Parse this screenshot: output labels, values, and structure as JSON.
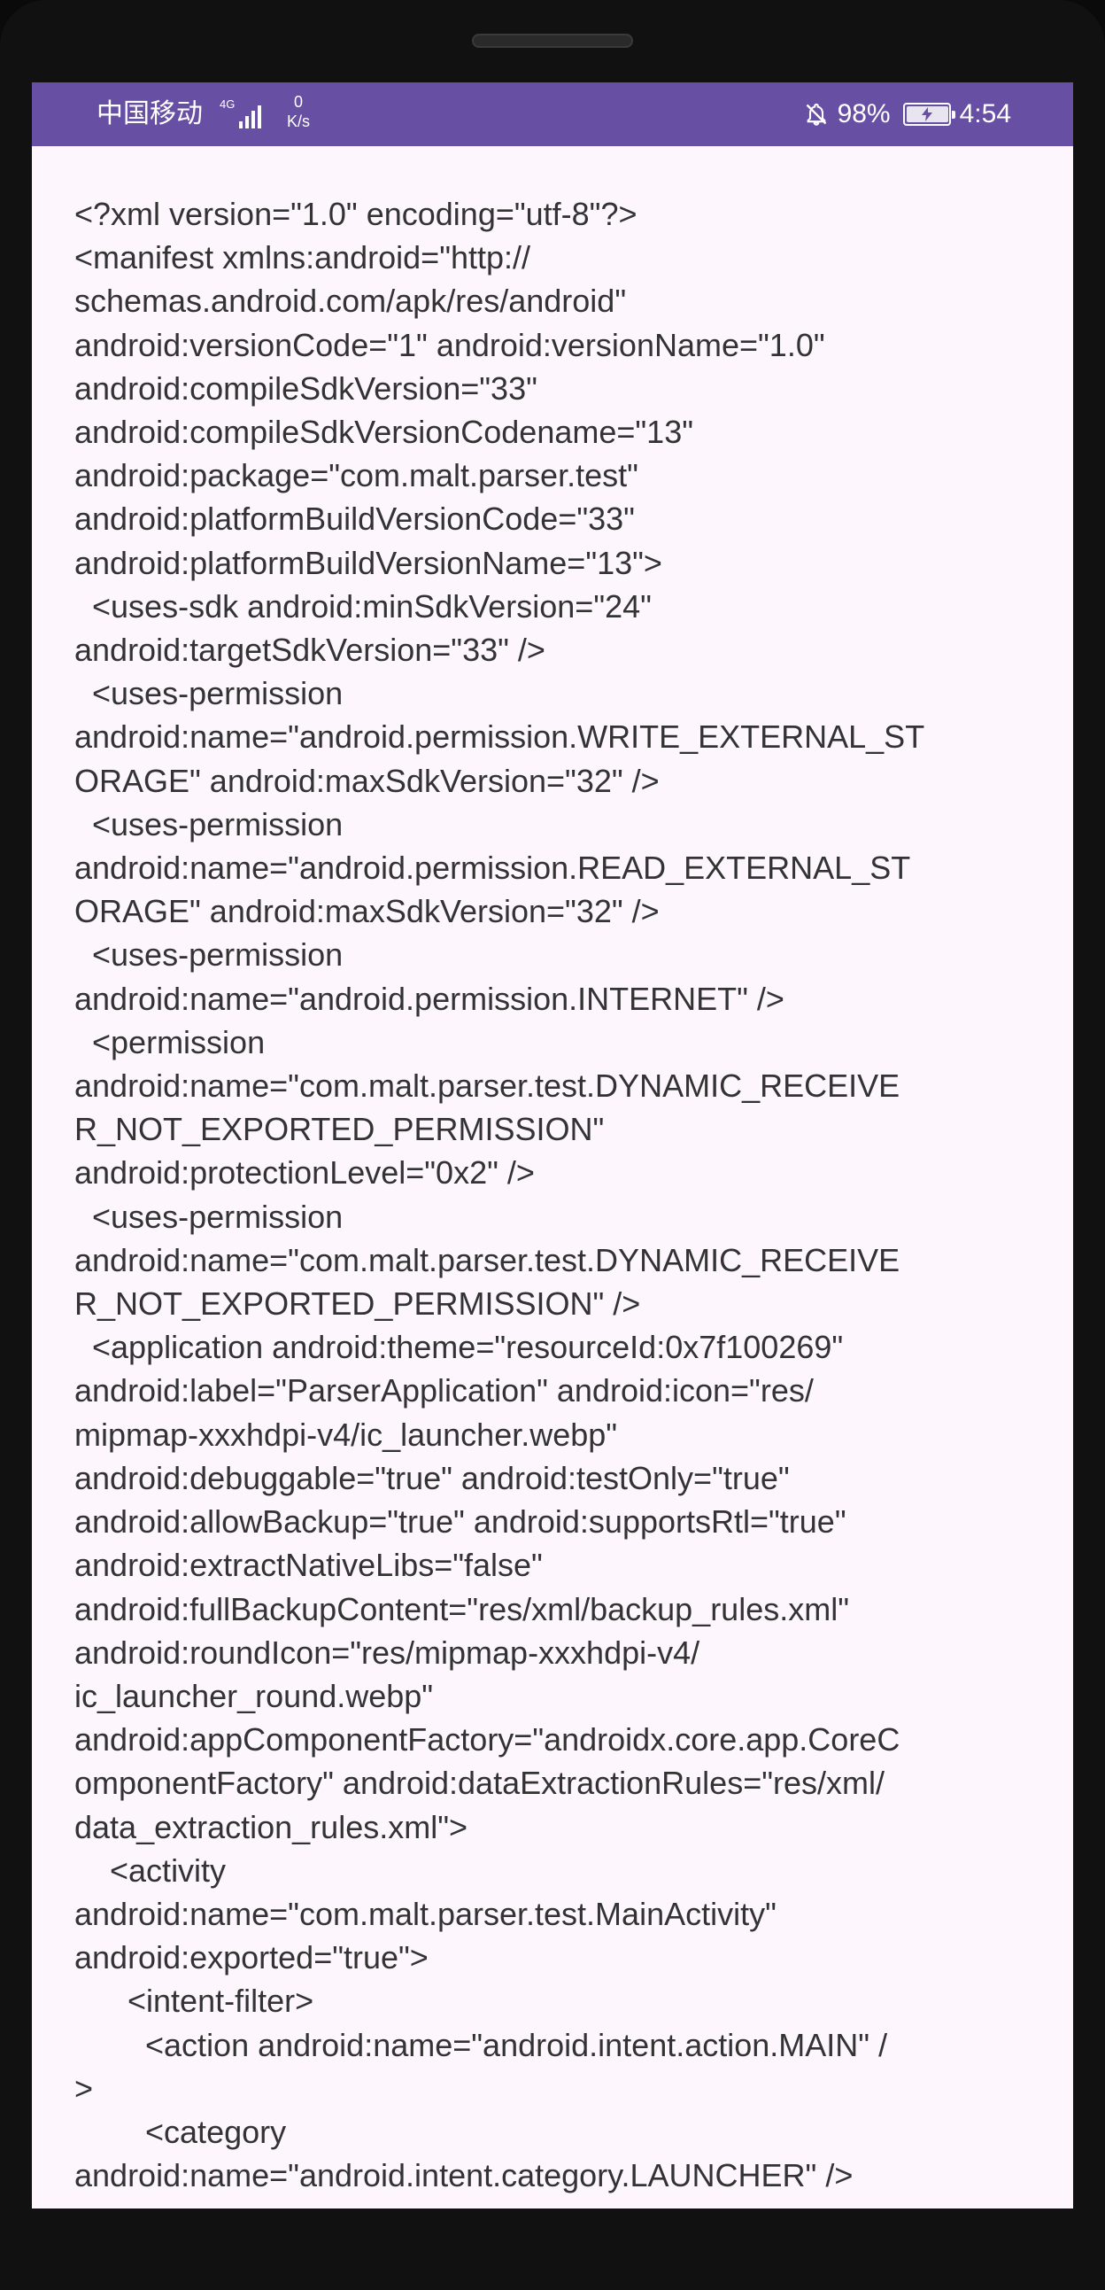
{
  "status_bar": {
    "carrier": "中国移动",
    "network": "4G",
    "speed_value": "0",
    "speed_unit": "K/s",
    "battery": "98%",
    "time": "4:54"
  },
  "manifest_lines": [
    "<?xml version=\"1.0\" encoding=\"utf-8\"?>",
    "<manifest xmlns:android=\"http://",
    "schemas.android.com/apk/res/android\"",
    "android:versionCode=\"1\" android:versionName=\"1.0\"",
    "android:compileSdkVersion=\"33\"",
    "android:compileSdkVersionCodename=\"13\"",
    "android:package=\"com.malt.parser.test\"",
    "android:platformBuildVersionCode=\"33\"",
    "android:platformBuildVersionName=\"13\">",
    "  <uses-sdk android:minSdkVersion=\"24\"",
    "android:targetSdkVersion=\"33\" />",
    "  <uses-permission",
    "android:name=\"android.permission.WRITE_EXTERNAL_ST",
    "ORAGE\" android:maxSdkVersion=\"32\" />",
    "  <uses-permission",
    "android:name=\"android.permission.READ_EXTERNAL_ST",
    "ORAGE\" android:maxSdkVersion=\"32\" />",
    "  <uses-permission",
    "android:name=\"android.permission.INTERNET\" />",
    "  <permission",
    "android:name=\"com.malt.parser.test.DYNAMIC_RECEIVE",
    "R_NOT_EXPORTED_PERMISSION\"",
    "android:protectionLevel=\"0x2\" />",
    "  <uses-permission",
    "android:name=\"com.malt.parser.test.DYNAMIC_RECEIVE",
    "R_NOT_EXPORTED_PERMISSION\" />",
    "  <application android:theme=\"resourceId:0x7f100269\"",
    "android:label=\"ParserApplication\" android:icon=\"res/",
    "mipmap-xxxhdpi-v4/ic_launcher.webp\"",
    "android:debuggable=\"true\" android:testOnly=\"true\"",
    "android:allowBackup=\"true\" android:supportsRtl=\"true\"",
    "android:extractNativeLibs=\"false\"",
    "android:fullBackupContent=\"res/xml/backup_rules.xml\"",
    "android:roundIcon=\"res/mipmap-xxxhdpi-v4/",
    "ic_launcher_round.webp\"",
    "android:appComponentFactory=\"androidx.core.app.CoreC",
    "omponentFactory\" android:dataExtractionRules=\"res/xml/",
    "data_extraction_rules.xml\">",
    "    <activity",
    "android:name=\"com.malt.parser.test.MainActivity\"",
    "android:exported=\"true\">",
    "      <intent-filter>",
    "        <action android:name=\"android.intent.action.MAIN\" /",
    ">",
    "        <category",
    "android:name=\"android.intent.category.LAUNCHER\" />"
  ]
}
